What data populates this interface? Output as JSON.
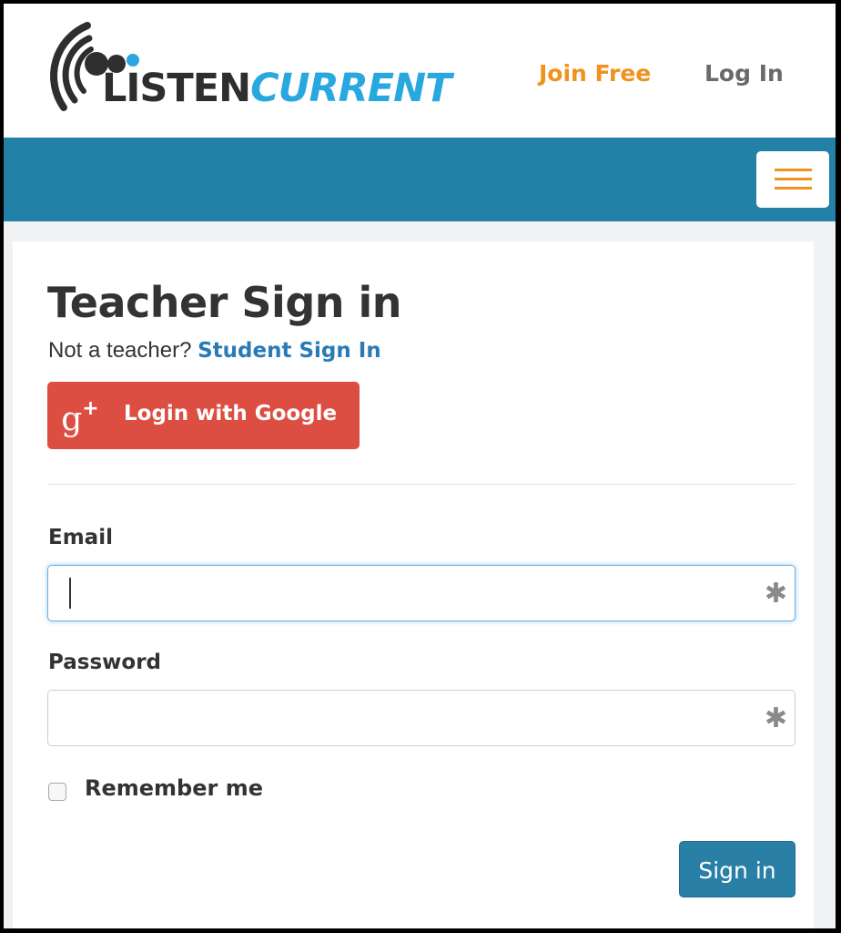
{
  "brand": {
    "logo_listen": "LISTEN",
    "logo_current": "CURRENT"
  },
  "nav": {
    "join_free": "Join Free",
    "log_in": "Log In"
  },
  "page": {
    "title": "Teacher Sign in",
    "not_teacher": "Not a teacher? ",
    "student_link": "Student Sign In"
  },
  "google": {
    "label": "Login with Google",
    "icon": "google-plus-icon"
  },
  "form": {
    "email_label": "Email",
    "email_value": "",
    "password_label": "Password",
    "password_value": "",
    "required_marker": "✱",
    "remember_label": "Remember me",
    "remember_checked": false,
    "submit_label": "Sign in"
  },
  "colors": {
    "band_blue": "#2380a6",
    "accent_orange": "#f0921e",
    "link_blue": "#2a7bb5",
    "google_red": "#dc4e41",
    "logo_cyan": "#29a8e0"
  }
}
